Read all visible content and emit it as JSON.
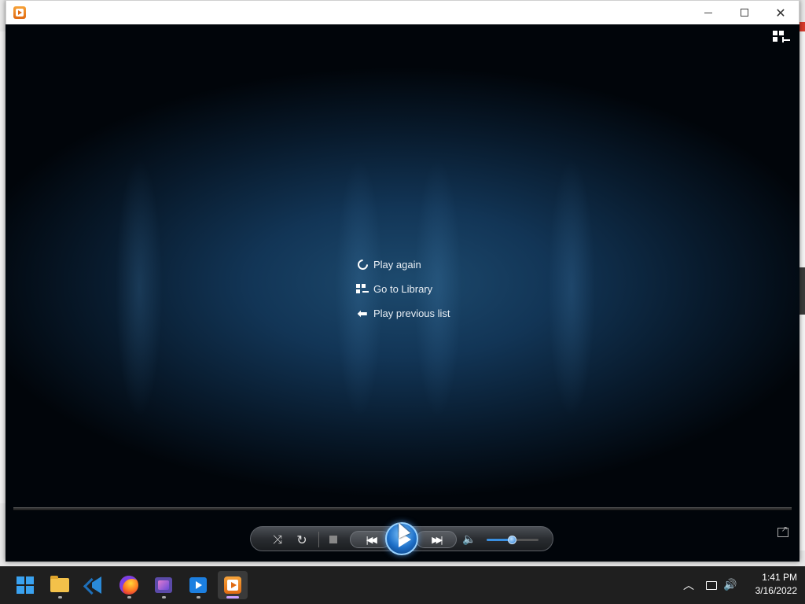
{
  "window": {
    "title": "",
    "controls": {
      "minimize": "—",
      "maximize": "☐",
      "close": "✕"
    }
  },
  "menu": {
    "items": [
      {
        "label": "Play again",
        "icon": "replay-icon"
      },
      {
        "label": "Go to Library",
        "icon": "library-icon"
      },
      {
        "label": "Play previous list",
        "icon": "back-arrow-icon"
      }
    ]
  },
  "transport": {
    "shuffle_icon": "shuffle-icon",
    "repeat_icon": "repeat-icon",
    "stop_icon": "stop-icon",
    "previous_icon": "previous-icon",
    "play_icon": "play-icon",
    "next_icon": "next-icon",
    "volume_icon": "volume-icon",
    "volume_level": 0.5,
    "accent_color": "#1e70c8"
  },
  "taskbar": {
    "apps": [
      {
        "name": "start",
        "icon": "windows-start-icon"
      },
      {
        "name": "file-explorer",
        "icon": "folder-icon"
      },
      {
        "name": "visual-studio-code",
        "icon": "vscode-icon"
      },
      {
        "name": "firefox",
        "icon": "firefox-icon"
      },
      {
        "name": "video-editor",
        "icon": "film-icon"
      },
      {
        "name": "movies-tv",
        "icon": "movie-icon"
      },
      {
        "name": "windows-media-player",
        "icon": "wmp-icon",
        "active": true
      }
    ],
    "clock": {
      "time": "1:41 PM",
      "date": "3/16/2022"
    }
  }
}
